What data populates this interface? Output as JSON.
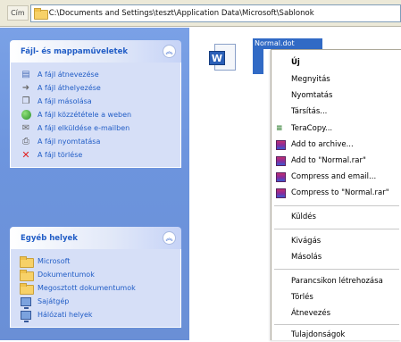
{
  "address_bar": {
    "label": "Cím",
    "path": "C:\\Documents and Settings\\teszt\\Application Data\\Microsoft\\Sablonok"
  },
  "task_pane": {
    "file_tasks": {
      "title": "Fájl- és mappaműveletek",
      "items": [
        {
          "label": "A fájl átnevezése",
          "icon": "rename-icon"
        },
        {
          "label": "A fájl áthelyezése",
          "icon": "move-icon"
        },
        {
          "label": "A fájl másolása",
          "icon": "copy-icon"
        },
        {
          "label": "A fájl közzététele a weben",
          "icon": "web-publish-icon"
        },
        {
          "label": "A fájl elküldése e-mailben",
          "icon": "mail-icon"
        },
        {
          "label": "A fájl nyomtatása",
          "icon": "print-icon"
        },
        {
          "label": "A fájl törlése",
          "icon": "delete-icon"
        }
      ]
    },
    "other_places": {
      "title": "Egyéb helyek",
      "items": [
        {
          "label": "Microsoft",
          "icon": "folder-icon"
        },
        {
          "label": "Dokumentumok",
          "icon": "folder-icon"
        },
        {
          "label": "Megosztott dokumentumok",
          "icon": "folder-icon"
        },
        {
          "label": "Sajátgép",
          "icon": "computer-icon"
        },
        {
          "label": "Hálózati helyek",
          "icon": "network-icon"
        }
      ]
    }
  },
  "file": {
    "name": "Normal.dot",
    "icon": "word-document-icon"
  },
  "context_menu": {
    "items": [
      {
        "label": "Új",
        "bold": true
      },
      {
        "label": "Megnyitás"
      },
      {
        "label": "Nyomtatás"
      },
      {
        "label": "Társítás..."
      },
      {
        "label": "TeraCopy...",
        "icon": "teracopy-icon"
      },
      {
        "label": "Add to archive...",
        "icon": "winrar-icon"
      },
      {
        "label": "Add to \"Normal.rar\"",
        "icon": "winrar-icon"
      },
      {
        "label": "Compress and email...",
        "icon": "winrar-icon"
      },
      {
        "label": "Compress to \"Normal.rar\"",
        "icon": "winrar-icon"
      },
      {
        "label": "Küldés"
      },
      {
        "label": "Kivágás"
      },
      {
        "label": "Másolás"
      },
      {
        "label": "Parancsikon létrehozása"
      },
      {
        "label": "Törlés"
      },
      {
        "label": "Átnevezés"
      },
      {
        "label": "Tulajdonságok"
      }
    ]
  }
}
